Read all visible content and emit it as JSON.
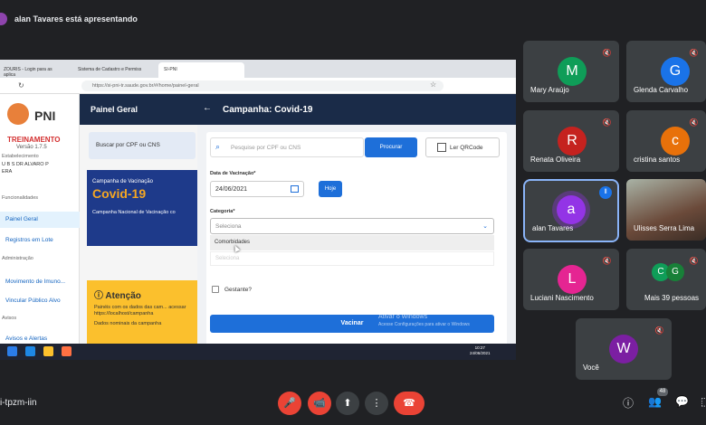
{
  "header": {
    "presenter_text": "alan Tavares está apresentando"
  },
  "browser": {
    "tabs": [
      "ZOURIS - Login para as aplica",
      "Sistema de Cadastro e Permiss",
      "SI-PNI"
    ],
    "url": "https://si-pni-tr.saude.gov.br/#/home/painel-geral"
  },
  "app": {
    "logo_text": "PNI",
    "env_label": "TREINAMENTO",
    "version": "Versão 1.7.5",
    "estab_label": "Estabelecimento",
    "estab_name": "U B S DR ALVARO P",
    "estab_sub": "ERA",
    "section_funcs": "Funcionalidades",
    "nav_painel": "Painel Geral",
    "nav_registros": "Registros em Lote",
    "section_admin": "Administração",
    "nav_mov": "Movimento de Imuno...",
    "nav_vinc": "Vincular Público Alvo",
    "section_avisos": "Avisos",
    "nav_avisos": "Avisos e Alertas",
    "main_title": "Painel Geral",
    "bg_search": "Buscar por CPF ou CNS",
    "campaign_label": "Campanha de Vacinação",
    "campaign_name": "Covid-19",
    "campaign_desc": "Campanha Nacional de Vacinação co",
    "attention_title": "Atenção",
    "attention_text": "Painéis com os dados das cam... acessar https://localhost/campanha",
    "attention_text2": "Dados nominais da campanha",
    "panel_title": "Campanha: Covid-19",
    "search_placeholder": "Pesquise por CPF ou CNS",
    "btn_search": "Procurar",
    "btn_qr": "Ler QRCode",
    "date_label": "Data de Vacinação*",
    "date_value": "24/06/2021",
    "btn_today": "Hoje",
    "category_label": "Categoria*",
    "category_placeholder": "Seleciona",
    "option_highlight": "Comorbidades",
    "option2": "Seleciona",
    "pregnant_label": "Gestante?",
    "btn_vaccinate": "Vacinar",
    "watermark1": "Ativar o Windows",
    "watermark2": "Acesse Configurações para ativar o Windows"
  },
  "taskbar": {
    "time": "10:27",
    "date": "24/06/2021"
  },
  "participants": [
    {
      "initial": "M",
      "name": "Mary Araújo",
      "color": "#0f9d58"
    },
    {
      "initial": "G",
      "name": "Glenda Carvalho",
      "color": "#1a73e8"
    },
    {
      "initial": "R",
      "name": "Renata Oliveira",
      "color": "#c5221f"
    },
    {
      "initial": "c",
      "name": "cristina santos",
      "color": "#e8710a"
    },
    {
      "initial": "a",
      "name": "alan Tavares",
      "color": "#9334e6"
    },
    {
      "initial": "",
      "name": "Ulisses Serra Lima",
      "color": ""
    },
    {
      "initial": "L",
      "name": "Luciani Nascimento",
      "color": "#e52592"
    },
    {
      "initial": "C",
      "name": "Mais 39 pessoas",
      "color": "#0f9d58"
    },
    {
      "initial": "W",
      "name": "Você",
      "color": "#7b1fa2"
    }
  ],
  "more_second": "G",
  "meeting": {
    "code": "i-tpzm-iin",
    "people_count": "48"
  }
}
